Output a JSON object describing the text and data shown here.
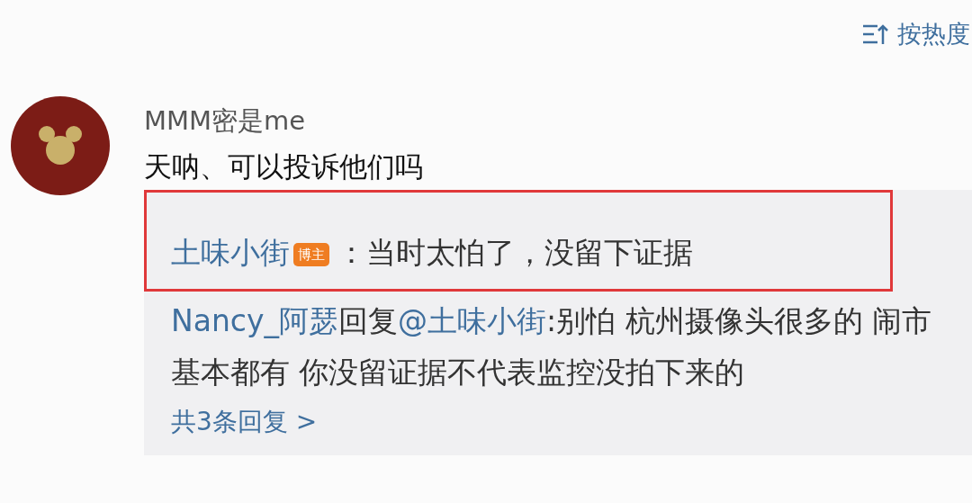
{
  "sort": {
    "label": "按热度"
  },
  "comment": {
    "author": "MMM密是me",
    "text": "天呐、可以投诉他们吗"
  },
  "replies": [
    {
      "author": "土味小街",
      "badge": "博主",
      "text": "：当时太怕了，没留下证据",
      "highlighted": true
    },
    {
      "author": "Nancy_阿瑟",
      "reply_word": "回复",
      "reply_to": "@土味小街",
      "text": ":别怕 杭州摄像头很多的 闹市基本都有 你没留证据不代表监控没拍下来的",
      "highlighted": false
    }
  ],
  "more_replies": "共3条回复 >"
}
